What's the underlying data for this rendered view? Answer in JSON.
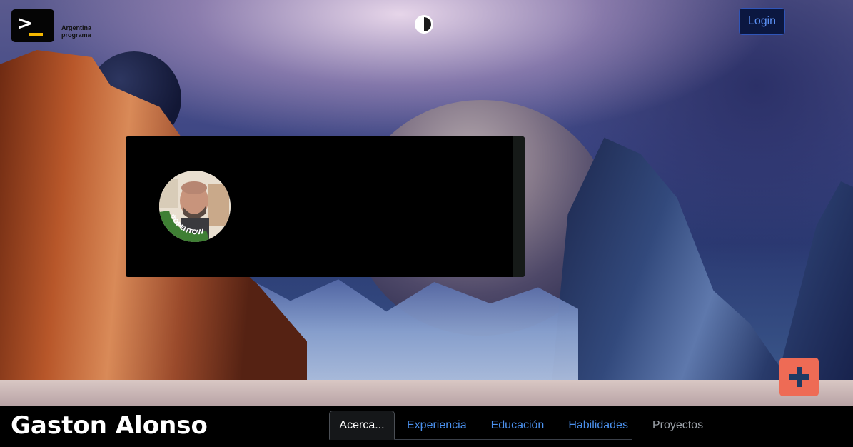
{
  "header": {
    "logo_text_line1": "Argentina",
    "logo_text_line2": "programa",
    "logo_prompt_symbol": ">",
    "theme_toggle_icon": "half-circle-contrast-icon",
    "login_label": "Login"
  },
  "profile_card": {
    "avatar_badge_text": "#OPENTOWORK"
  },
  "fab": {
    "icon": "plus-icon"
  },
  "footer": {
    "name": "Gaston Alonso",
    "tabs": [
      {
        "label": "Acerca..."
      },
      {
        "label": "Experiencia"
      },
      {
        "label": "Educación"
      },
      {
        "label": "Habilidades"
      },
      {
        "label": "Proyectos"
      }
    ]
  },
  "colors": {
    "accent_link": "#4b91ee",
    "login_border": "#2f55b8",
    "fab_background": "#ee6b55",
    "logo_cursor": "#f5b800",
    "opentowork_green": "#3f7f34"
  }
}
